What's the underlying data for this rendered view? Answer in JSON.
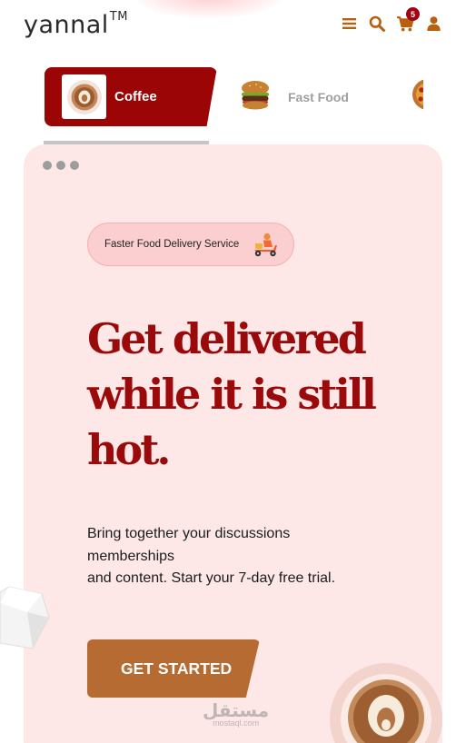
{
  "brand": {
    "name": "yannal",
    "tm": "TM"
  },
  "nav": {
    "icons": [
      "menu-icon",
      "search-icon",
      "cart-icon",
      "user-icon"
    ],
    "cart_count": "5",
    "accent": "#b8600f"
  },
  "categories": [
    {
      "label": "Coffee",
      "active": true
    },
    {
      "label": "Fast Food",
      "active": false
    }
  ],
  "hero": {
    "badge": "Faster Food Delivery Service",
    "headline": "Get delivered while it is still hot.",
    "description_lines": [
      "Bring together your discussions",
      "memberships",
      "and content. Start your 7-day free trial."
    ],
    "cta_label": "GET STARTED"
  },
  "watermark": {
    "arabic": "مستقل",
    "latin": "mostaql.com"
  },
  "colors": {
    "brand_red": "#9b0505",
    "cta_brown": "#b56b31",
    "hero_bg": "#fde7e7",
    "pill_bg": "#fbcfcf"
  }
}
